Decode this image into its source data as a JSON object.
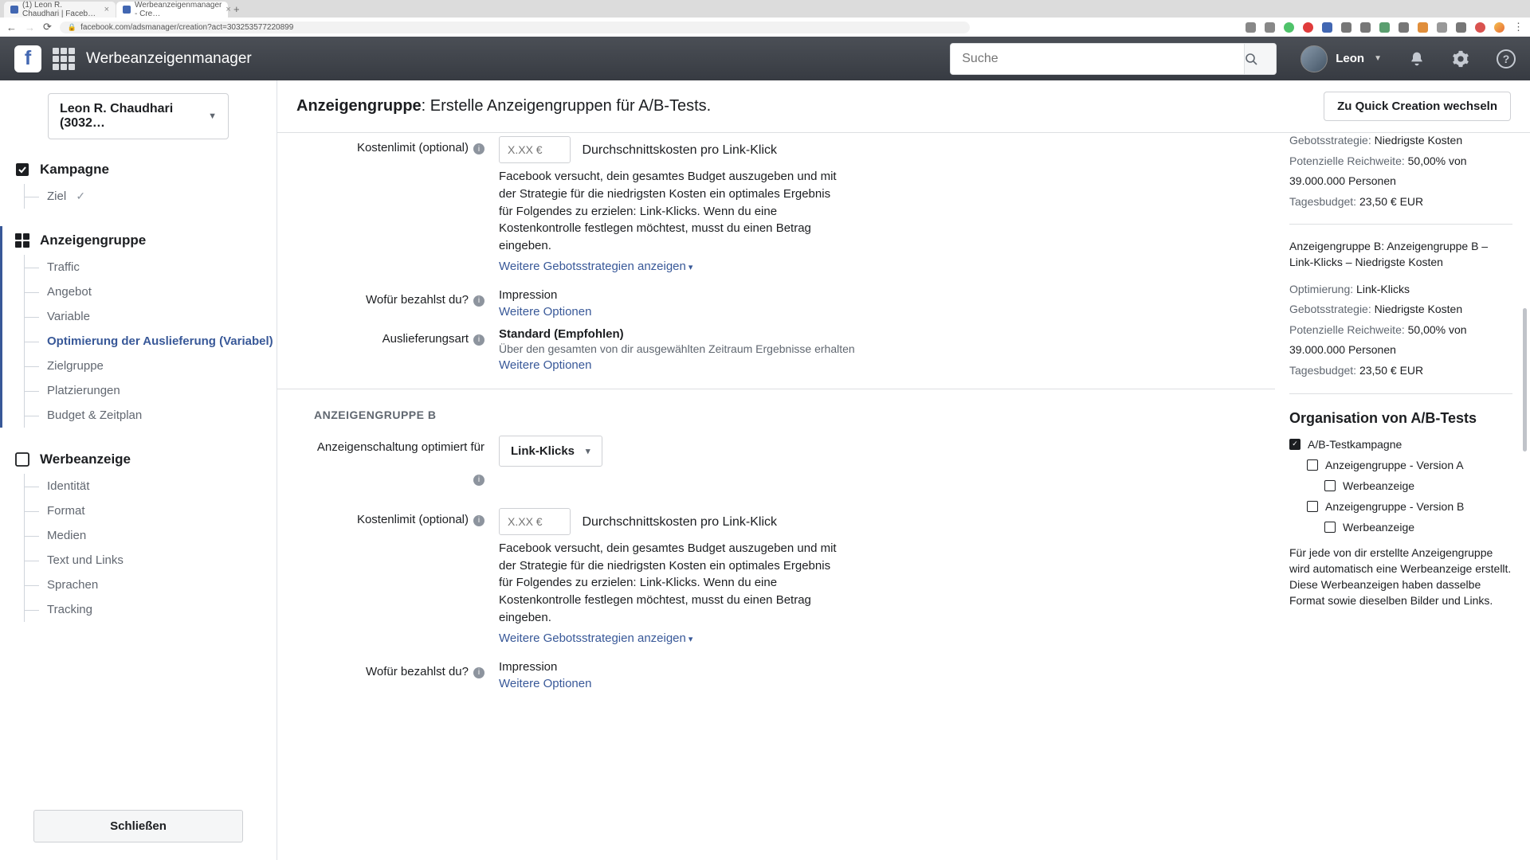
{
  "browser": {
    "tab1": "(1) Leon R. Chaudhari | Faceb…",
    "tab2": "Werbeanzeigenmanager - Cre…",
    "url": "facebook.com/adsmanager/creation?act=303253577220899"
  },
  "fbbar": {
    "title": "Werbeanzeigenmanager",
    "search_ph": "Suche",
    "username": "Leon"
  },
  "sidebar": {
    "account": "Leon R. Chaudhari (3032…",
    "campaign": "Kampagne",
    "goal": "Ziel",
    "adset": "Anzeigengruppe",
    "items": [
      "Traffic",
      "Angebot",
      "Variable",
      "Optimierung der Auslieferung (Variabel)",
      "Zielgruppe",
      "Platzierungen",
      "Budget & Zeitplan"
    ],
    "ad": "Werbeanzeige",
    "ad_items": [
      "Identität",
      "Format",
      "Medien",
      "Text und Links",
      "Sprachen",
      "Tracking"
    ],
    "close": "Schließen"
  },
  "header": {
    "strong": "Anzeigengruppe",
    "rest": ": Erstelle Anzeigengruppen für A/B-Tests.",
    "quick": "Zu Quick Creation wechseln"
  },
  "form": {
    "cost_label": "Kostenlimit (optional)",
    "cost_ph": "X.XX €",
    "cost_suffix": "Durchschnittskosten pro Link-Klick",
    "cost_help": "Facebook versucht, dein gesamtes Budget auszugeben und mit der Strategie für die niedrigsten Kosten ein optimales Ergebnis für Folgendes zu erzielen: Link-Klicks. Wenn du eine Kostenkontrolle festlegen möchtest, musst du einen Betrag eingeben.",
    "more_bid": "Weitere Gebotsstrategien anzeigen",
    "pay_label": "Wofür bezahlst du?",
    "pay_val": "Impression",
    "more_opt": "Weitere Optionen",
    "delivery_label": "Auslieferungsart",
    "delivery_val": "Standard (Empfohlen)",
    "delivery_sub": "Über den gesamten von dir ausgewählten Zeitraum Ergebnisse erhalten",
    "group_b": "Anzeigengruppe B",
    "opt_label": "Anzeigenschaltung optimiert für",
    "opt_val": "Link-Klicks"
  },
  "rail": {
    "strategy_lbl": "Gebotsstrategie: ",
    "strategy_val": "Niedrigste Kosten",
    "reach_lbl": "Potenzielle Reichweite: ",
    "reach_val": "50,00% von",
    "reach_num": "39.000.000 Personen",
    "budget_lbl": "Tagesbudget: ",
    "budget_val": "23,50 € EUR",
    "gb_lbl": "Anzeigengruppe B: ",
    "gb_val": "Anzeigengruppe B – Link-Klicks – Niedrigste Kosten",
    "optim_lbl": "Optimierung: ",
    "optim_val": "Link-Klicks",
    "org_h": "Organisation von A/B-Tests",
    "org1": "A/B-Testkampagne",
    "org2": "Anzeigengruppe - Version A",
    "org3": "Werbeanzeige",
    "org4": "Anzeigengruppe - Version B",
    "org5": "Werbeanzeige",
    "note": "Für jede von dir erstellte Anzeigengruppe wird automatisch eine Werbeanzeige erstellt. Diese Werbeanzeigen haben dasselbe Format sowie dieselben Bilder und Links."
  }
}
